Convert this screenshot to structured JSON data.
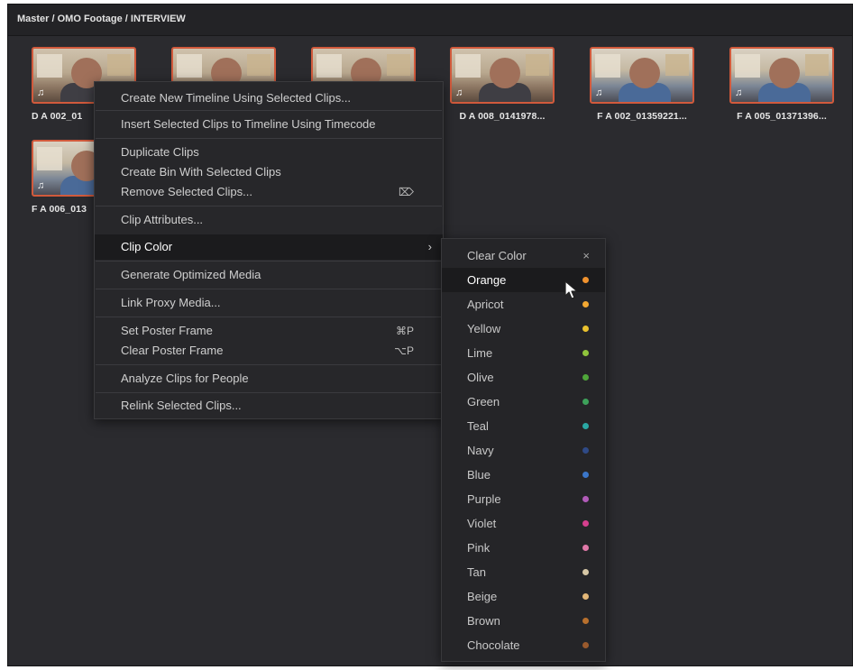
{
  "path": "Master / OMO Footage / INTERVIEW",
  "clips": [
    {
      "label": "D A 002_01"
    },
    {
      "label": ""
    },
    {
      "label": ""
    },
    {
      "label": "D A 008_0141978..."
    },
    {
      "label": "F A 002_01359221..."
    },
    {
      "label": "F A 005_01371396..."
    },
    {
      "label": "F A 006_013"
    }
  ],
  "menu": {
    "items": [
      {
        "label": "Create New Timeline Using Selected Clips..."
      },
      {
        "label": "Insert Selected Clips to Timeline Using Timecode"
      },
      {
        "label": "Duplicate Clips"
      },
      {
        "label": "Create Bin With Selected Clips"
      },
      {
        "label": "Remove Selected Clips...",
        "shortcut": "⌦"
      },
      {
        "label": "Clip Attributes..."
      },
      {
        "label": "Clip Color",
        "chevron": "›"
      },
      {
        "label": "Generate Optimized Media"
      },
      {
        "label": "Link Proxy Media..."
      },
      {
        "label": "Set Poster Frame",
        "shortcut": "⌘P"
      },
      {
        "label": "Clear Poster Frame",
        "shortcut": "⌥P"
      },
      {
        "label": "Analyze Clips for People"
      },
      {
        "label": "Relink Selected Clips..."
      }
    ]
  },
  "color_submenu": {
    "clear": {
      "label": "Clear Color",
      "icon": "×"
    },
    "colors": [
      {
        "label": "Orange",
        "hex": "#f0922e"
      },
      {
        "label": "Apricot",
        "hex": "#f3a832"
      },
      {
        "label": "Yellow",
        "hex": "#e9c12e"
      },
      {
        "label": "Lime",
        "hex": "#8fc43c"
      },
      {
        "label": "Olive",
        "hex": "#4fa63a"
      },
      {
        "label": "Green",
        "hex": "#3da15a"
      },
      {
        "label": "Teal",
        "hex": "#2aa8a4"
      },
      {
        "label": "Navy",
        "hex": "#2f4a86"
      },
      {
        "label": "Blue",
        "hex": "#3b76c9"
      },
      {
        "label": "Purple",
        "hex": "#b15bb8"
      },
      {
        "label": "Violet",
        "hex": "#d63f8e"
      },
      {
        "label": "Pink",
        "hex": "#e079a8"
      },
      {
        "label": "Tan",
        "hex": "#d6c7a6"
      },
      {
        "label": "Beige",
        "hex": "#e3b778"
      },
      {
        "label": "Brown",
        "hex": "#b8702d"
      },
      {
        "label": "Chocolate",
        "hex": "#9a5a2d"
      }
    ]
  }
}
